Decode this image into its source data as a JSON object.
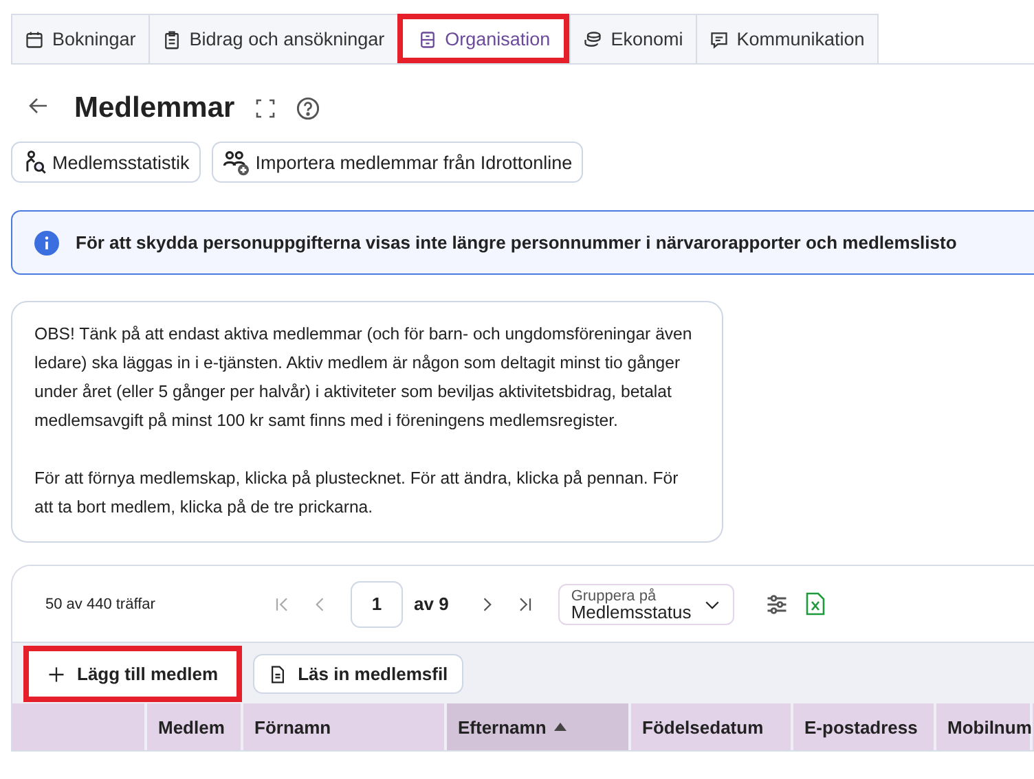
{
  "tabs": [
    {
      "label": "Bokningar",
      "selected": false,
      "highlighted": false
    },
    {
      "label": "Bidrag och ansökningar",
      "selected": false,
      "highlighted": false
    },
    {
      "label": "Organisation",
      "selected": true,
      "highlighted": true
    },
    {
      "label": "Ekonomi",
      "selected": false,
      "highlighted": false
    },
    {
      "label": "Kommunikation",
      "selected": false,
      "highlighted": false
    }
  ],
  "page": {
    "title": "Medlemmar"
  },
  "actions": [
    {
      "label": "Medlemsstatistik"
    },
    {
      "label": "Importera medlemmar från Idrottonline"
    }
  ],
  "info_banner": {
    "text": "För att skydda personuppgifterna visas inte längre personnummer i närvarorapporter och medlemslisto"
  },
  "notice": {
    "paragraphs": [
      "OBS! Tänk på att endast aktiva medlemmar (och för barn- och ungdomsföreningar även ledare) ska läggas in i e-tjänsten. Aktiv medlem är någon som deltagit minst tio gånger under året (eller 5 gånger per halvår) i aktiviteter som beviljas aktivitetsbidrag, betalat medlemsavgift på minst 100 kr samt finns med i föreningens medlemsregister.",
      "För att förnya medlemskap, klicka på plustecknet. För att ändra, klicka på pennan. För att ta bort medlem, klicka på de tre prickarna."
    ]
  },
  "table": {
    "hits": "50 av 440 träffar",
    "page": "1",
    "page_total": "av 9",
    "group_by": {
      "label": "Gruppera på",
      "value": "Medlemsstatus"
    },
    "buttons": [
      {
        "label": "Lägg till medlem",
        "highlighted": true
      },
      {
        "label": "Läs in medlemsfil",
        "highlighted": false
      }
    ],
    "columns": [
      {
        "sorted": false
      },
      {
        "label": "Medlem",
        "sorted": false
      },
      {
        "label": "Förnamn",
        "sorted": false
      },
      {
        "label": "Efternamn",
        "sorted": true
      },
      {
        "label": "Födelsedatum",
        "sorted": false
      },
      {
        "label": "E-postadress",
        "sorted": false
      },
      {
        "label": "Mobilnum",
        "sorted": false
      }
    ]
  }
}
